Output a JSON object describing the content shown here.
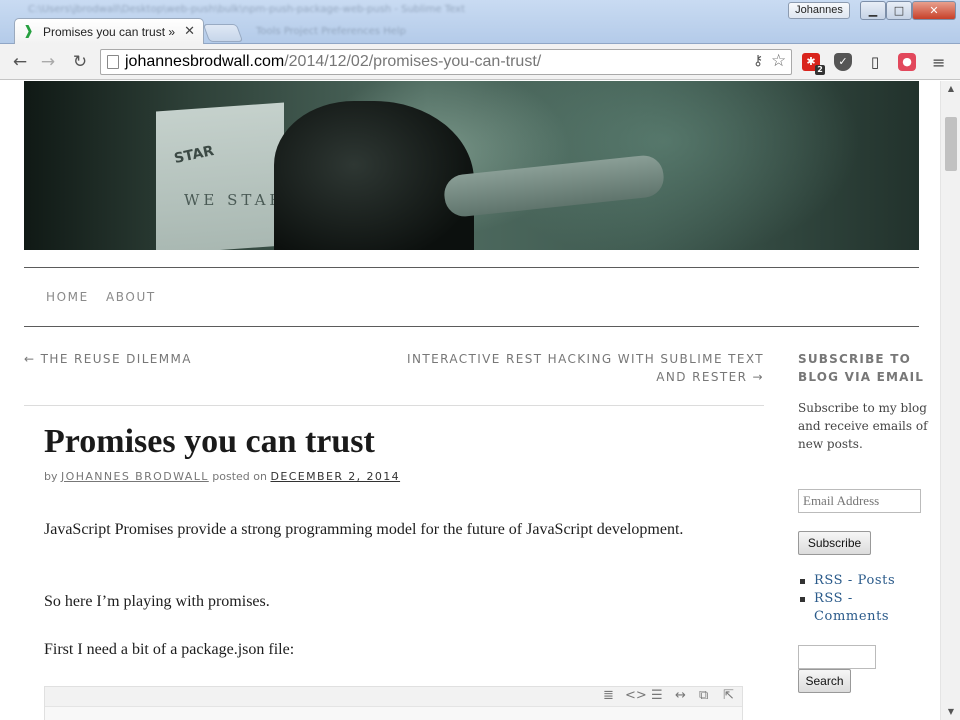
{
  "window": {
    "blurred_title": "C:\\Users\\jbrodwall\\Desktop\\web-push\\bulk\\npm-push-package-web-push - Sublime Text",
    "profile_name": "Johannes",
    "minimize": "▁",
    "maximize": "□",
    "close": "✕"
  },
  "tab": {
    "title": "Promises you can trust » T",
    "favicon": "❱",
    "close": "✕"
  },
  "background_menu": "Tools   Project   Preferences   Help",
  "toolbar": {
    "back": "←",
    "forward": "→",
    "reload": "↻",
    "url_host": "johannesbrodwall.com",
    "url_path": "/2014/12/02/promises-you-can-trust/",
    "key_icon": "⚷",
    "star_icon": "☆",
    "ext_badge": "2",
    "menu": "≡"
  },
  "header_image": {
    "sign_text_1": "STAR",
    "sign_text_2": "WE   STAR"
  },
  "site_nav": {
    "home": "HOME",
    "about": "ABOUT"
  },
  "post_nav": {
    "previous": "← THE REUSE DILEMMA",
    "next_line1": "INTERACTIVE REST HACKING WITH SUBLIME TEXT",
    "next_line2": "AND RESTER →"
  },
  "post": {
    "title": "Promises you can trust",
    "by_label": "by",
    "author": "JOHANNES BRODWALL",
    "posted_on_label": "posted on",
    "date": "DECEMBER 2, 2014",
    "paragraph1": "JavaScript Promises provide a strong programming model for the future of JavaScript development.",
    "paragraph2": "So here I’m playing with promises.",
    "paragraph3": "First I need a bit of a package.json file:"
  },
  "code_toolbar_icons": [
    "≣",
    "<>",
    "☰",
    "↔",
    "⧉",
    "⇱"
  ],
  "sidebar": {
    "subscribe_title": "SUBSCRIBE TO BLOG VIA EMAIL",
    "subscribe_text": "Subscribe to my blog and receive emails of new posts.",
    "email_placeholder": "Email Address",
    "subscribe_button": "Subscribe",
    "rss_posts": "RSS - Posts",
    "rss_comments": "RSS - Comments",
    "search_button": "Search"
  }
}
